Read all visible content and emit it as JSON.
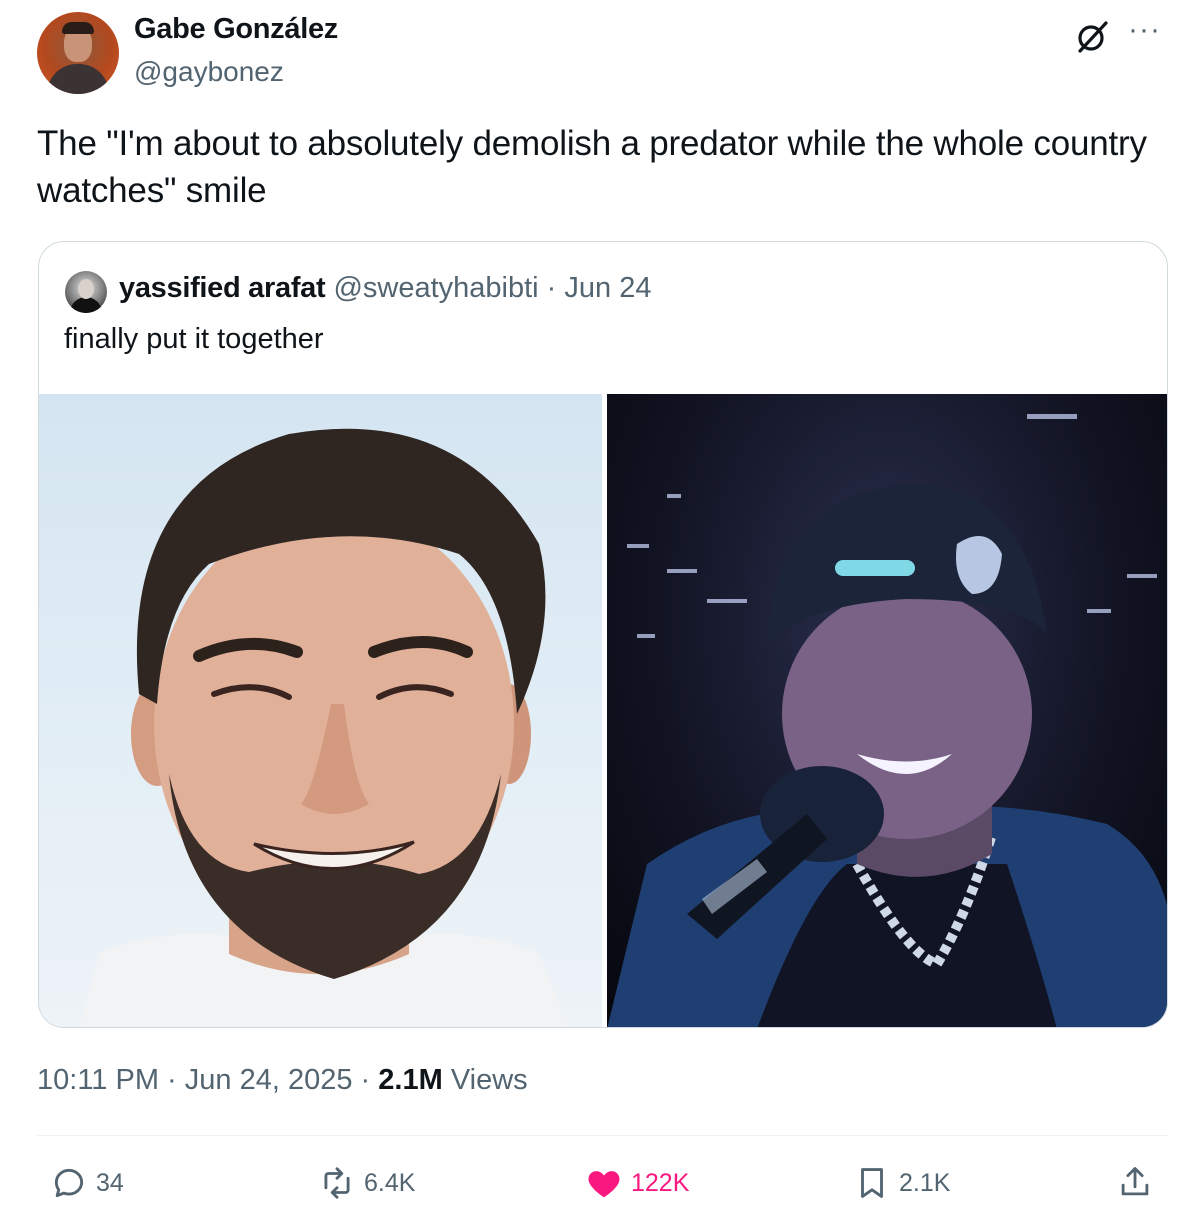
{
  "author": {
    "name": "Gabe González",
    "handle": "@gaybonez",
    "icons": [
      "grok-icon",
      "more-icon"
    ]
  },
  "tweet_text": "The \"I'm about to absolutely demolish a predator while the whole country watches\" smile",
  "quoted": {
    "name": "yassified arafat",
    "handle": "@sweatyhabibti",
    "separator": "·",
    "date": "Jun 24",
    "text": "finally put it together"
  },
  "meta": {
    "time": "10:11 PM",
    "sep1": "·",
    "date": "Jun 24, 2025",
    "sep2": "·",
    "views_count": "2.1M",
    "views_label": "Views"
  },
  "actions": {
    "replies": "34",
    "reposts": "6.4K",
    "likes": "122K",
    "bookmarks": "2.1K"
  },
  "colors": {
    "text": "#0f1419",
    "secondary": "#536471",
    "like": "#f91880",
    "border": "#cfd9de"
  }
}
